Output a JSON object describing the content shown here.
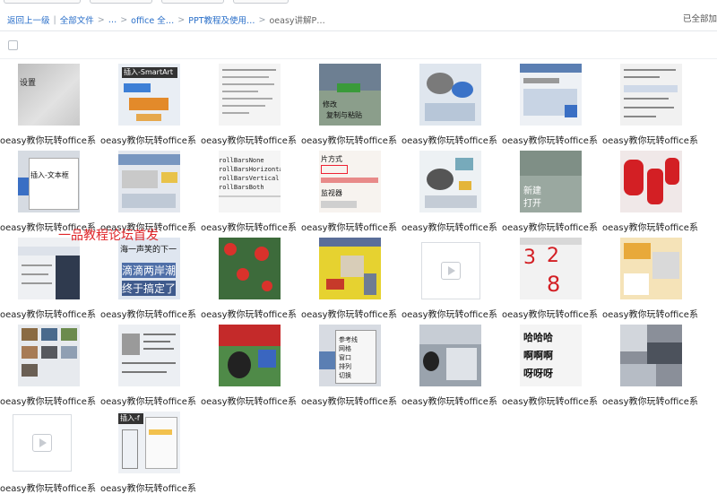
{
  "breadcrumb": {
    "back": "返回上一级",
    "all_files": "全部文件",
    "ellipsis": "…",
    "items": [
      "office 全…",
      "PPT教程及使用…",
      "oeasy讲解P…"
    ]
  },
  "loaded_note": "已全部加",
  "file_label": "oeasy教你玩转office系…",
  "overlay_text": "一品教程论坛首发",
  "thumb_texts": {
    "t1": "插入-SmartArt",
    "t2": "插入-文本框",
    "t3": "海一声笑的下一",
    "t4": "滴滴两岸潮",
    "t5": "终于搞定了",
    "t6": "哈哈哈",
    "t7": "啊啊啊",
    "t8": "呀呀呀",
    "t9": "插入-f",
    "t10": "新建",
    "t11": "打开",
    "t12": "参考线",
    "t13": "网格",
    "t14": "窗口",
    "t15": "排列",
    "t16": "切换",
    "t17": "片方式",
    "t18": "监视器",
    "t19": "设置",
    "t20": "修改",
    "t21": "复制与粘贴"
  }
}
